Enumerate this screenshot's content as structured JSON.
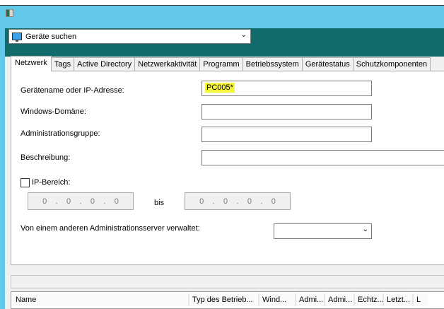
{
  "header": {
    "device_select": "Geräte suchen"
  },
  "tabs": [
    "Netzwerk",
    "Tags",
    "Active Directory",
    "Netzwerkaktivität",
    "Programm",
    "Betriebssystem",
    "Gerätestatus",
    "Schutzkomponenten"
  ],
  "form": {
    "device_name_label": "Gerätename oder IP-Adresse:",
    "device_name_value": "PC005*",
    "domain_label": "Windows-Domäne:",
    "domain_value": "",
    "group_label": "Administrationsgruppe:",
    "group_value": "",
    "description_label": "Beschreibung:",
    "description_value": "",
    "ip_range_label": "IP-Bereich:",
    "ip_range_checked": false,
    "ip_from": [
      "0",
      "0",
      "0",
      "0"
    ],
    "to_label": "bis",
    "ip_to": [
      "0",
      "0",
      "0",
      "0"
    ],
    "managed_label": "Von einem anderen Administrationsserver verwaltet:",
    "managed_value": ""
  },
  "list": {
    "columns": [
      "Name",
      "Typ des Betrieb...",
      "Wind...",
      "Admi...",
      "Admi...",
      "Echtz...",
      "Letzt...",
      "L"
    ]
  }
}
